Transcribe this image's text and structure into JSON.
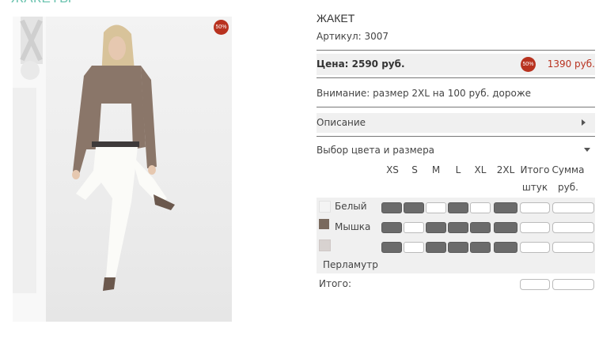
{
  "page": {
    "section_title": "ЖАКЕТЫ"
  },
  "product": {
    "image_badge": "50%",
    "title": "ЖАКЕТ",
    "article": "Артикул: 3007",
    "price_label": "Цена: 2590 руб.",
    "price_badge": "50%",
    "new_price": "1390 руб.",
    "notice": "Внимание: размер 2XL на 100 руб. дороже",
    "description_label": "Описание",
    "choose_label": "Выбор цвета и размера"
  },
  "size_table": {
    "sizes": [
      "XS",
      "S",
      "M",
      "L",
      "XL",
      "2XL"
    ],
    "qty_header": [
      "Итого",
      "штук"
    ],
    "sum_header": [
      "Сумма",
      "руб."
    ],
    "rows": [
      {
        "color": "Белый",
        "swatch": "#f4f4f4",
        "available": [
          true,
          true,
          false,
          true,
          false,
          true
        ]
      },
      {
        "color": "Мышка",
        "swatch": "#7a6a5e",
        "available": [
          true,
          false,
          true,
          true,
          true,
          true
        ]
      },
      {
        "color": "Перламутр",
        "swatch": "#d8d2d0",
        "available": [
          true,
          false,
          true,
          true,
          true,
          true
        ]
      }
    ],
    "total_label": "Итого:"
  },
  "colors": {
    "accent": "#6dc4b0",
    "sale": "#b8321f",
    "cell_filled": "#6b6b6b"
  }
}
